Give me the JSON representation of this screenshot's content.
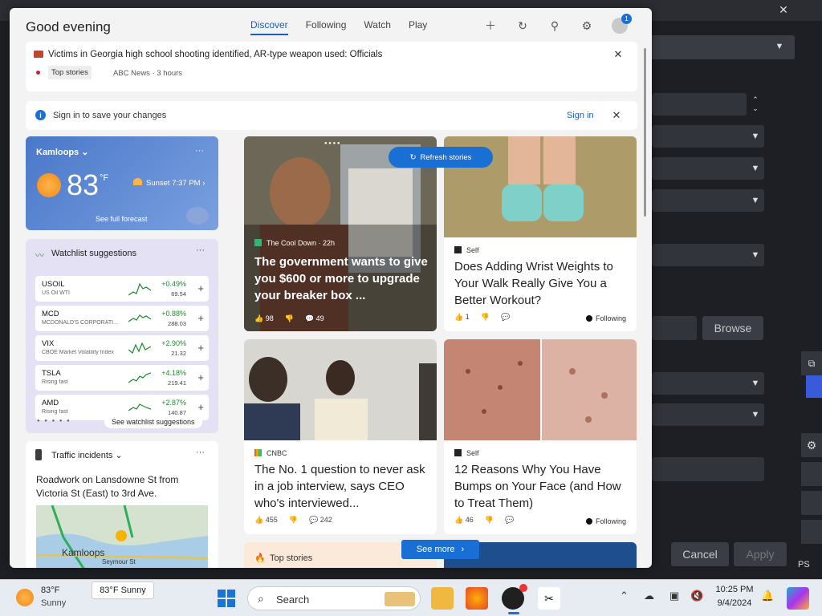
{
  "background_app": {
    "browse_label": "Browse",
    "cancel_label": "Cancel",
    "apply_label": "Apply",
    "ps_label": "PS"
  },
  "header": {
    "greeting": "Good evening",
    "tabs": [
      "Discover",
      "Following",
      "Watch",
      "Play"
    ],
    "active_tab": "Discover",
    "icons": [
      "plus-icon",
      "refresh-icon",
      "pin-icon",
      "gear-icon",
      "avatar"
    ],
    "avatar_badge": "1"
  },
  "top_news": {
    "title": "Victims in Georgia high school shooting identified, AR-type weapon used: Officials",
    "tag": "Top stories",
    "source": "ABC News · 3 hours"
  },
  "signin_bar": {
    "text": "Sign in to save your changes",
    "link": "Sign in"
  },
  "weather": {
    "city": "Kamloops",
    "temp": "83",
    "unit": "°F",
    "sunset": "Sunset 7:37 PM",
    "forecast_link": "See full forecast"
  },
  "watchlist": {
    "title": "Watchlist suggestions",
    "items": [
      {
        "symbol": "USOIL",
        "name": "US Oil WTI",
        "change": "+0.49%",
        "price": "69.54"
      },
      {
        "symbol": "MCD",
        "name": "MCDONALD'S CORPORATI...",
        "change": "+0.88%",
        "price": "288.03"
      },
      {
        "symbol": "VIX",
        "name": "CBOE Market Volatility Index",
        "change": "+2.90%",
        "price": "21.32"
      },
      {
        "symbol": "TSLA",
        "name": "Rising fast",
        "change": "+4.18%",
        "price": "219.41"
      },
      {
        "symbol": "AMD",
        "name": "Rising fast",
        "change": "+2.87%",
        "price": "140.87"
      }
    ],
    "link": "See watchlist suggestions"
  },
  "traffic": {
    "title": "Traffic incidents",
    "text": "Roadwork on Lansdowne St from Victoria St (East) to 3rd Ave.",
    "map_label": "Kamloops",
    "map_street": "Seymour St"
  },
  "stories": [
    {
      "source": "The Cool Down · 22h",
      "title": "The government wants to give you $600 or more to upgrade your breaker box ...",
      "likes": "98",
      "comments": "49"
    },
    {
      "source": "Self",
      "title": "Does Adding Wrist Weights to Your Walk Really Give You a Better Workout?",
      "likes": "1",
      "following": "Following"
    },
    {
      "source": "CNBC",
      "title": "The No. 1 question to never ask in a job interview, says CEO who's interviewed...",
      "likes": "455",
      "comments": "242"
    },
    {
      "source": "Self",
      "title": "12 Reasons Why You Have Bumps on Your Face (and How to Treat Them)",
      "likes": "46",
      "following": "Following"
    }
  ],
  "refresh_label": "Refresh stories",
  "top_stories_label": "Top stories",
  "see_more_label": "See more",
  "taskbar": {
    "weather_temp": "83°F",
    "weather_cond": "Sunny",
    "tooltip": "83°F Sunny",
    "search_placeholder": "Search",
    "time": "10:25 PM",
    "date": "9/4/2024"
  }
}
